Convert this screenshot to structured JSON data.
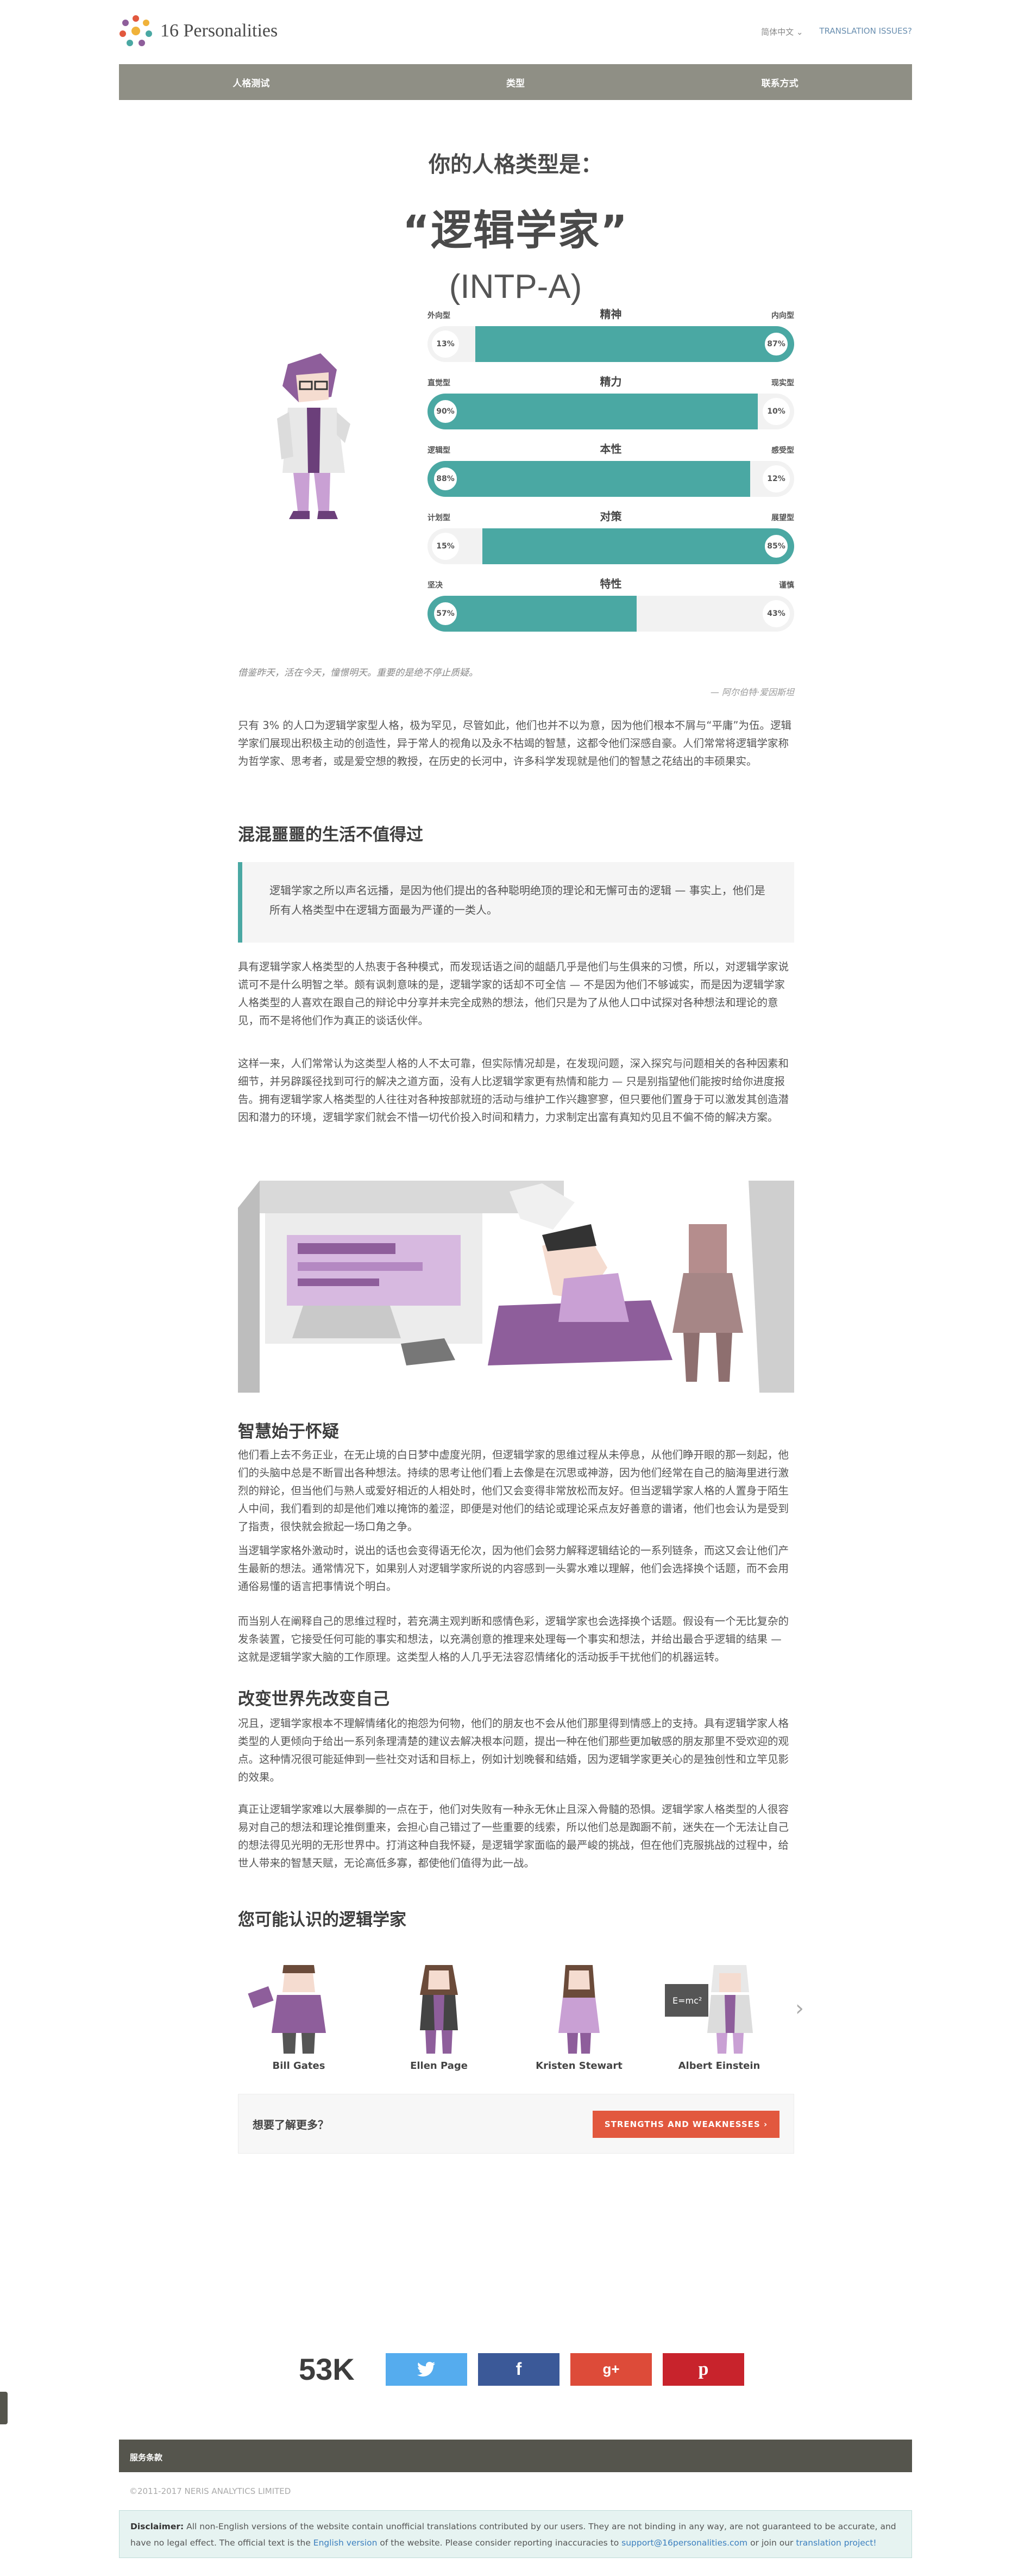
{
  "header": {
    "logo_text": "16 Personalities",
    "lang_label": "简体中文 ⌄",
    "translation_link": "TRANSLATION ISSUES?"
  },
  "nav": [
    "人格测试",
    "类型",
    "联系方式"
  ],
  "result": {
    "intro": "你的人格类型是：",
    "type_name": "“逻辑学家”",
    "type_code": "(INTP-A)"
  },
  "traits": [
    {
      "category": "精神",
      "left": "外向型",
      "right": "内向型",
      "left_pct": "13%",
      "right_pct": "87%",
      "dominant": "right",
      "value": 87
    },
    {
      "category": "精力",
      "left": "直觉型",
      "right": "现实型",
      "left_pct": "90%",
      "right_pct": "10%",
      "dominant": "left",
      "value": 90
    },
    {
      "category": "本性",
      "left": "逻辑型",
      "right": "感受型",
      "left_pct": "88%",
      "right_pct": "12%",
      "dominant": "left",
      "value": 88
    },
    {
      "category": "对策",
      "left": "计划型",
      "right": "展望型",
      "left_pct": "15%",
      "right_pct": "85%",
      "dominant": "right",
      "value": 85
    },
    {
      "category": "特性",
      "left": "坚决",
      "right": "谨慎",
      "left_pct": "57%",
      "right_pct": "43%",
      "dominant": "left",
      "value": 57
    }
  ],
  "quote": {
    "text": "借鉴昨天，活在今天，憧憬明天。重要的是绝不停止质疑。",
    "source": "— 阿尔伯特·爱因斯坦"
  },
  "content": {
    "p1": "只有 3% 的人口为逻辑学家型人格，极为罕见，尽管如此，他们也并不以为意，因为他们根本不屑与“平庸”为伍。逻辑学家们展现出积极主动的创造性，异于常人的视角以及永不枯竭的智慧，这都令他们深感自豪。人们常常将逻辑学家称为哲学家、思考者，或是爱空想的教授，在历史的长河中，许多科学发现就是他们的智慧之花结出的丰硕果实。",
    "h_life": "混混噩噩的生活不值得过",
    "callout": "逻辑学家之所以声名远播，是因为他们提出的各种聪明绝顶的理论和无懈可击的逻辑 — 事实上，他们是所有人格类型中在逻辑方面最为严谨的一类人。",
    "p2": "具有逻辑学家人格类型的人热衷于各种模式，而发现话语之间的龃龉几乎是他们与生俱来的习惯，所以，对逻辑学家说谎可不是什么明智之举。颇有讽刺意味的是，逻辑学家的话却不可全信 — 不是因为他们不够诚实，而是因为逻辑学家人格类型的人喜欢在跟自己的辩论中分享并未完全成熟的想法，他们只是为了从他人口中试探对各种想法和理论的意见，而不是将他们作为真正的谈话伙伴。",
    "p3": "这样一来，人们常常认为这类型人格的人不太可靠，但实际情况却是，在发现问题，深入探究与问题相关的各种因素和细节，并另辟蹊径找到可行的解决之道方面，没有人比逻辑学家更有热情和能力 — 只是别指望他们能按时给你进度报告。拥有逻辑学家人格类型的人往往对各种按部就班的活动与维护工作兴趣寥寥，但只要他们置身于可以激发其创造潜因和潜力的环境，逻辑学家们就会不惜一切代价投入时间和精力，力求制定出富有真知灼见且不偏不倚的解决方案。",
    "h_doubt": "智慧始于怀疑",
    "p4": "他们看上去不务正业，在无止境的白日梦中虚度光阴，但逻辑学家的思维过程从未停息，从他们睁开眼的那一刻起，他们的头脑中总是不断冒出各种想法。持续的思考让他们看上去像是在沉思或神游，因为他们经常在自己的脑海里进行激烈的辩论，但当他们与熟人或爱好相近的人相处时，他们又会变得非常放松而友好。但当逻辑学家人格的人置身于陌生人中间，我们看到的却是他们难以掩饰的羞涩，即便是对他们的结论或理论采点友好善意的谱诸，他们也会认为是受到了指责，很快就会掀起一场口角之争。",
    "p5": "当逻辑学家格外激动时，说出的话也会变得语无伦次，因为他们会努力解释逻辑结论的一系列链条，而这又会让他们产生最新的想法。通常情况下，如果别人对逻辑学家所说的内容感到一头雾水难以理解，他们会选择换个话题，而不会用通俗易懂的语言把事情说个明白。",
    "p6": "而当别人在阐释自己的思维过程时，若充满主观判断和感情色彩，逻辑学家也会选择换个话题。假设有一个无比复杂的发条装置，它接受任何可能的事实和想法，以充满创意的推理来处理每一个事实和想法，并给出最合乎逻辑的结果 — 这就是逻辑学家大脑的工作原理。这类型人格的人几乎无法容忍情绪化的活动扳手干扰他们的机器运转。",
    "h_change": "改变世界先改变自己",
    "p7": "况且，逻辑学家根本不理解情绪化的抱怨为何物，他们的朋友也不会从他们那里得到情感上的支持。具有逻辑学家人格类型的人更倾向于给出一系列条理清楚的建议去解决根本问题，提出一种在他们那些更加敏感的朋友那里不受欢迎的观点。这种情况很可能延伸到一些社交对话和目标上，例如计划晚餐和结婚，因为逻辑学家更关心的是独创性和立竿见影的效果。",
    "p8": "真正让逻辑学家难以大展拳脚的一点在于，他们对失败有一种永无休止且深入骨髓的恐惧。逻辑学家人格类型的人很容易对自己的想法和理论推倒重来，会担心自己错过了一些重要的线索，所以他们总是踟蹰不前，迷失在一个无法让自己的想法得见光明的无形世界中。打消这种自我怀疑，是逻辑学家面临的最严峻的挑战，但在他们克服挑战的过程中，给世人带来的智慧天赋，无论高低多寡，都使他们值得为此一战。",
    "h_famous": "您可能认识的逻辑学家"
  },
  "famous": [
    "Bill Gates",
    "Ellen Page",
    "Kristen Stewart",
    "Albert Einstein"
  ],
  "more": {
    "question": "想要了解更多？",
    "button": "STRENGTHS AND WEAKNESSES ›"
  },
  "share": {
    "count": "53K"
  },
  "footer": {
    "bar": "服务条款",
    "copyright": "©2011-2017 NERIS ANALYTICS LIMITED",
    "disclaimer_label": "Disclaimer:",
    "disclaimer_1": "All non-English versions of the website contain unofficial translations contributed by our users. They are not binding in any way, are not guaranteed to be accurate, and have no legal effect. The official text is the",
    "english_link": "English version",
    "disclaimer_2": "of the website. Please consider reporting inaccuracies to",
    "email": "support@16personalities.com",
    "disclaimer_3": "or join our",
    "project_link": "translation project!"
  },
  "colors": {
    "accent": "#4aa8a3",
    "nav": "#8f8f85",
    "cta": "#e2583e",
    "footer": "#55554d"
  }
}
